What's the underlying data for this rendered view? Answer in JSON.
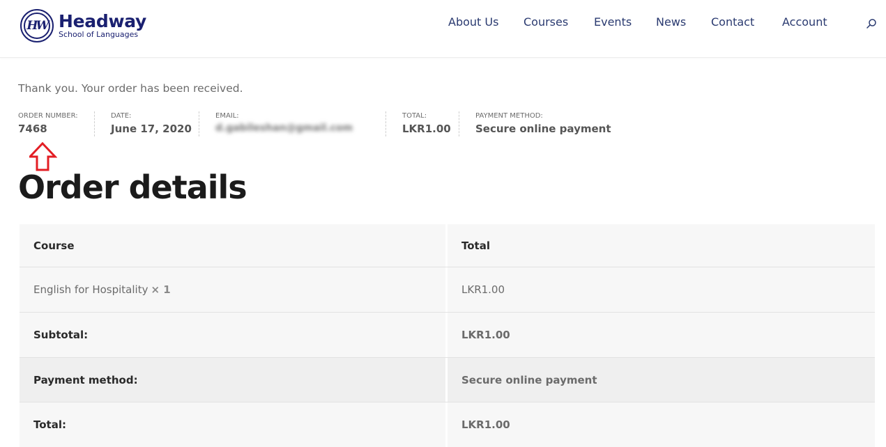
{
  "header": {
    "logo": {
      "monogram": "HW",
      "name": "Headway",
      "tagline": "School of Languages"
    },
    "nav": [
      {
        "label": "About Us"
      },
      {
        "label": "Courses"
      },
      {
        "label": "Events"
      },
      {
        "label": "News"
      },
      {
        "label": "Contact"
      },
      {
        "label": "Account"
      }
    ],
    "search_icon": "search-icon"
  },
  "order": {
    "thank_you": "Thank you. Your order has been received.",
    "overview": {
      "order_number_label": "ORDER NUMBER:",
      "order_number": "7468",
      "date_label": "DATE:",
      "date": "June 17, 2020",
      "email_label": "EMAIL:",
      "email": "d.gabileshan@gmail.com",
      "total_label": "TOTAL:",
      "total": "LKR1.00",
      "payment_label": "PAYMENT METHOD:",
      "payment": "Secure online payment"
    },
    "annotation_icon": "up-arrow-icon",
    "annotation_color": "#e31e24"
  },
  "details": {
    "title": "Order details",
    "columns": {
      "course": "Course",
      "total": "Total"
    },
    "item": {
      "name": "English for Hospitality",
      "qty": "× 1",
      "total": "LKR1.00"
    },
    "subtotal": {
      "label": "Subtotal:",
      "value": "LKR1.00"
    },
    "payment_method": {
      "label": "Payment method:",
      "value": "Secure online payment"
    },
    "total": {
      "label": "Total:",
      "value": "LKR1.00"
    }
  },
  "colors": {
    "brand_navy": "#1a2070",
    "nav_text": "#2a3a70",
    "heading": "#1b1b1b"
  }
}
